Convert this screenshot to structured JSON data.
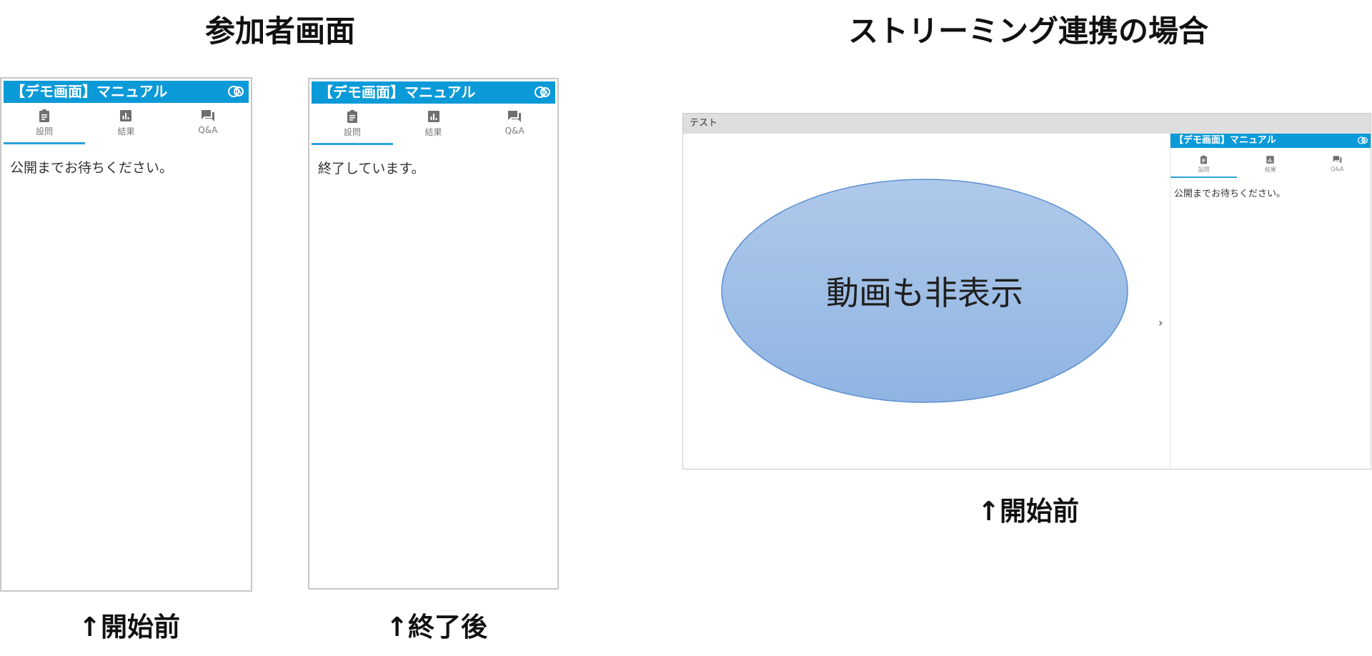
{
  "headings": {
    "participant": "参加者画面",
    "streaming": "ストリーミング連携の場合"
  },
  "captions": {
    "before": "↑開始前",
    "after": "↑終了後",
    "stream_before": "↑開始前"
  },
  "app": {
    "title": "【デモ画面】マニュアル",
    "tabs": [
      {
        "label": "設問",
        "icon": "clipboard-icon"
      },
      {
        "label": "結果",
        "icon": "bar-chart-icon"
      },
      {
        "label": "Q&A",
        "icon": "chat-icon"
      }
    ],
    "accent_color": "#0b9ad8"
  },
  "phones": [
    {
      "message": "公開までお待ちください。",
      "active_tab": 0
    },
    {
      "message": "終了しています。",
      "active_tab": 0
    }
  ],
  "stream": {
    "window_title": "テスト",
    "video_label": "動画も非表示",
    "toggle_glyph": "›",
    "panel_message": "公開までお待ちください。"
  }
}
